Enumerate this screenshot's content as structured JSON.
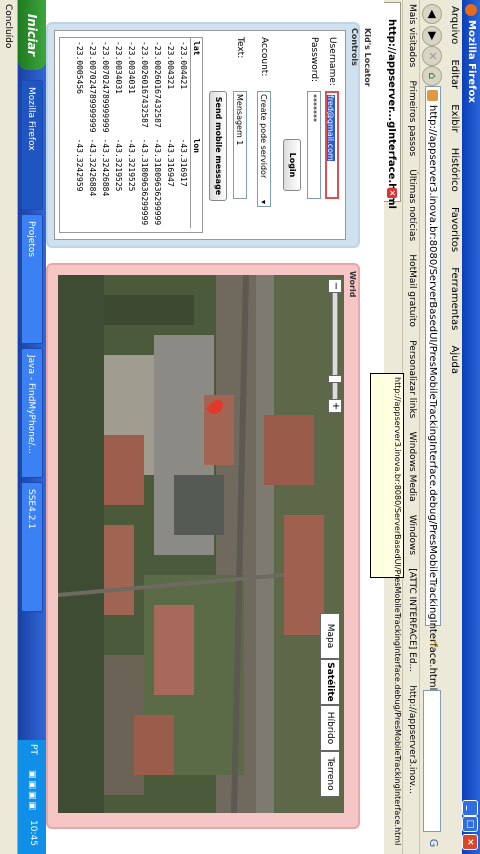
{
  "window": {
    "title": "Mozilla Firefox",
    "minimize": "_",
    "maximize": "□",
    "close": "×"
  },
  "menu": [
    "Arquivo",
    "Editar",
    "Exibir",
    "Histórico",
    "Favoritos",
    "Ferramentas",
    "Ajuda"
  ],
  "nav": {
    "url": "http://appserver3.inova.br:8080/ServerBasedUI/PresMobileTrackingInterface.debug/PresMobileTrackingInterface.html"
  },
  "bookmarks": [
    "Mais visitados",
    "Primeiros passos",
    "Últimas notícias",
    "HotMail gratuito",
    "Personalizar links",
    "Windows Media",
    "Windows",
    "[ATTC INTERFACE] Ed...",
    "http://appserver3.inov..."
  ],
  "tab": {
    "title": "http://appserver...gInterface.html"
  },
  "tooltip": {
    "text": "http://appserver3.inova.br:8080/ServerBasedUI/PresMobileTrackingInterface.debug/PresMobileTrackingInterface.html"
  },
  "panels": {
    "controls_title": "Controls",
    "kid_title": "Kid's Locator",
    "world_title": "World"
  },
  "login": {
    "username_label": "Username:",
    "username_value": "fred@gmail.com",
    "password_label": "Password:",
    "password_value": "*******",
    "login_button": "Login"
  },
  "account": {
    "label": "Account:",
    "select_value": "Create pode servidor"
  },
  "text": {
    "label": "Text:",
    "value": "Mensagem 1",
    "send_button": "Send mobile message"
  },
  "table": {
    "headers": [
      "lat",
      "lon"
    ],
    "rows": [
      [
        "-23.004421",
        "-43.316917"
      ],
      [
        "-23.004321",
        "-43.316947"
      ],
      [
        "-23.00260167432587",
        "-43.31809636299999"
      ],
      [
        "-23.00260167432587",
        "-43.31809636299999"
      ],
      [
        "-23.0034031",
        "-43.3219525"
      ],
      [
        "-23.0034031",
        "-43.3219525"
      ],
      [
        "-23.007024789999999",
        "-43.32426884"
      ],
      [
        "-23.007024789999999",
        "-43.32426884"
      ],
      [
        "-23.0005456",
        "-43.3242959"
      ]
    ]
  },
  "map": {
    "types": [
      "Mapa",
      "Satélite",
      "Híbrido",
      "Terreno"
    ],
    "zoom_in": "+",
    "zoom_out": "−"
  },
  "taskbar": {
    "start": "Iniciar",
    "tasks": [
      "Mozilla Firefox",
      "Projetos",
      "Java - FindMyPhone/...",
      "SSE4.2.1"
    ],
    "lang": "PT",
    "clock": "10:45"
  },
  "status": {
    "text": "Concluído"
  }
}
